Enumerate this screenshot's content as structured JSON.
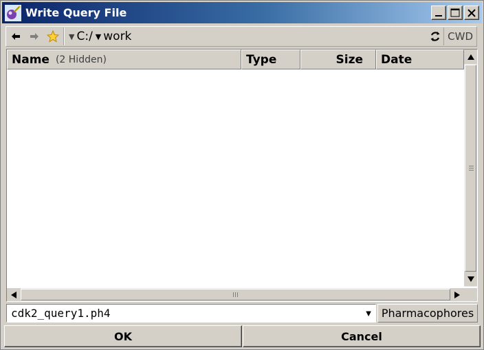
{
  "window": {
    "title": "Write Query File",
    "icons": {
      "app": "molecule-app-icon",
      "minimize": "minimize-icon",
      "maximize": "maximize-icon",
      "close": "close-icon"
    }
  },
  "toolbar": {
    "icons": {
      "back": "back-arrow-icon",
      "forward": "forward-arrow-icon",
      "favorites": "star-icon",
      "refresh": "refresh-icon"
    },
    "path": [
      {
        "label": "C:/"
      },
      {
        "label": "work"
      }
    ],
    "cwd_label": "CWD"
  },
  "file_list": {
    "columns": {
      "name": "Name",
      "hidden_note": "(2 Hidden)",
      "type": "Type",
      "size": "Size",
      "date": "Date"
    },
    "rows": []
  },
  "filename": {
    "value": "cdk2_query1.ph4"
  },
  "filter": {
    "label": "Pharmacophores"
  },
  "buttons": {
    "ok": "OK",
    "cancel": "Cancel"
  }
}
